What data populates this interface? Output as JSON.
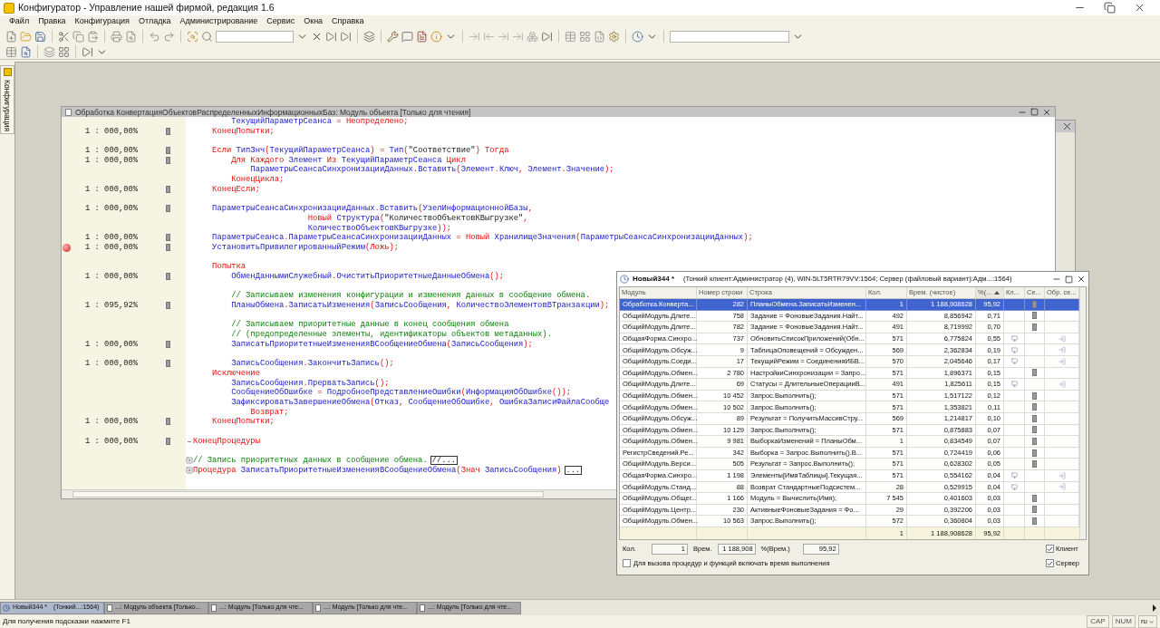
{
  "window": {
    "title": "Конфигуратор - Управление нашей фирмой, редакция 1.6"
  },
  "menu": [
    "Файл",
    "Правка",
    "Конфигурация",
    "Отладка",
    "Администрирование",
    "Сервис",
    "Окна",
    "Справка"
  ],
  "side_tab": {
    "label": "Конфигурация"
  },
  "code_window": {
    "title": "Обработка КонвертацияОбъектовРаспределенныхИнформационныхБаз: Модуль объекта [Только для чтения]",
    "lines": [
      {
        "breakpoint": false,
        "segments": [
          {
            "kind": "id",
            "text": "        ТекущийПараметрСеанса"
          },
          {
            "kind": "kw",
            "text": " = Неопределено;"
          }
        ]
      },
      {
        "count": "1 : 000,00%",
        "breakpoint": false,
        "segments": [
          {
            "kind": "kw",
            "text": "    КонецПопытки;"
          }
        ]
      },
      {
        "breakpoint": false
      },
      {
        "count": "1 : 000,00%",
        "breakpoint": false,
        "segments": [
          {
            "kind": "kw",
            "text": "    Если "
          },
          {
            "kind": "id",
            "text": "ТипЗнч"
          },
          {
            "kind": "kw",
            "text": "("
          },
          {
            "kind": "id",
            "text": "ТекущийПараметрСеанса"
          },
          {
            "kind": "kw",
            "text": ") = "
          },
          {
            "kind": "id",
            "text": "Тип"
          },
          {
            "kind": "kw",
            "text": "("
          },
          {
            "kind": "str",
            "text": "\"Соответствие\""
          },
          {
            "kind": "kw",
            "text": ") Тогда"
          }
        ]
      },
      {
        "count": "1 : 000,00%",
        "breakpoint": false,
        "segments": [
          {
            "kind": "kw",
            "text": "        Для Каждого "
          },
          {
            "kind": "id",
            "text": "Элемент "
          },
          {
            "kind": "kw",
            "text": "Из "
          },
          {
            "kind": "id",
            "text": "ТекущийПараметрСеанса "
          },
          {
            "kind": "kw",
            "text": "Цикл"
          }
        ]
      },
      {
        "breakpoint": false,
        "segments": [
          {
            "kind": "id",
            "text": "            ПараметрыСеансаСинхронизацииДанных"
          },
          {
            "kind": "kw",
            "text": "."
          },
          {
            "kind": "id",
            "text": "Вставить"
          },
          {
            "kind": "kw",
            "text": "("
          },
          {
            "kind": "id",
            "text": "Элемент"
          },
          {
            "kind": "kw",
            "text": "."
          },
          {
            "kind": "id",
            "text": "Ключ"
          },
          {
            "kind": "kw",
            "text": ", "
          },
          {
            "kind": "id",
            "text": "Элемент"
          },
          {
            "kind": "kw",
            "text": "."
          },
          {
            "kind": "id",
            "text": "Значение"
          },
          {
            "kind": "kw",
            "text": ");"
          }
        ]
      },
      {
        "breakpoint": false,
        "segments": [
          {
            "kind": "kw",
            "text": "        КонецЦикла;"
          }
        ]
      },
      {
        "count": "1 : 000,00%",
        "breakpoint": false,
        "segments": [
          {
            "kind": "kw",
            "text": "    КонецЕсли;"
          }
        ]
      },
      {
        "breakpoint": false
      },
      {
        "count": "1 : 000,00%",
        "breakpoint": false,
        "segments": [
          {
            "kind": "id",
            "text": "    ПараметрыСеансаСинхронизацииДанных"
          },
          {
            "kind": "kw",
            "text": "."
          },
          {
            "kind": "id",
            "text": "Вставить"
          },
          {
            "kind": "kw",
            "text": "("
          },
          {
            "kind": "id",
            "text": "УзелИнформационнойБазы"
          },
          {
            "kind": "kw",
            "text": ","
          }
        ]
      },
      {
        "breakpoint": false,
        "segments": [
          {
            "kind": "kw",
            "text": "                        Новый "
          },
          {
            "kind": "id",
            "text": "Структура"
          },
          {
            "kind": "kw",
            "text": "("
          },
          {
            "kind": "str",
            "text": "\"КоличествоОбъектовКВыгрузке\""
          },
          {
            "kind": "kw",
            "text": ","
          }
        ]
      },
      {
        "breakpoint": false,
        "segments": [
          {
            "kind": "id",
            "text": "                        КоличествоОбъектовКВыгрузке"
          },
          {
            "kind": "kw",
            "text": "));"
          }
        ]
      },
      {
        "count": "1 : 000,00%",
        "breakpoint": false,
        "segments": [
          {
            "kind": "id",
            "text": "    ПараметрыСеанса"
          },
          {
            "kind": "kw",
            "text": "."
          },
          {
            "kind": "id",
            "text": "ПараметрыСеансаСинхронизацииДанных"
          },
          {
            "kind": "kw",
            "text": " = Новый "
          },
          {
            "kind": "id",
            "text": "ХранилищеЗначения"
          },
          {
            "kind": "kw",
            "text": "("
          },
          {
            "kind": "id",
            "text": "ПараметрыСеансаСинхронизацииДанных"
          },
          {
            "kind": "kw",
            "text": ");"
          }
        ]
      },
      {
        "count": "1 : 000,00%",
        "breakpoint": true,
        "segments": [
          {
            "kind": "id",
            "text": "    УстановитьПривилегированныйРежим"
          },
          {
            "kind": "kw",
            "text": "(Ложь);"
          }
        ]
      },
      {
        "breakpoint": false
      },
      {
        "breakpoint": false,
        "segments": [
          {
            "kind": "kw",
            "text": "    Попытка"
          }
        ]
      },
      {
        "count": "1 : 000,00%",
        "breakpoint": false,
        "segments": [
          {
            "kind": "id",
            "text": "        ОбменДаннымиСлужебный"
          },
          {
            "kind": "kw",
            "text": "."
          },
          {
            "kind": "id",
            "text": "ОчиститьПриоритетныеДанныеОбмена"
          },
          {
            "kind": "kw",
            "text": "();"
          }
        ]
      },
      {
        "breakpoint": false
      },
      {
        "breakpoint": false,
        "segments": [
          {
            "kind": "cm",
            "text": "        // Записываем изменения конфигурации и изменения данных в сообщение обмена."
          }
        ]
      },
      {
        "count": "1 : 095,92%",
        "breakpoint": false,
        "segments": [
          {
            "kind": "id",
            "text": "        ПланыОбмена"
          },
          {
            "kind": "kw",
            "text": "."
          },
          {
            "kind": "id",
            "text": "ЗаписатьИзменения"
          },
          {
            "kind": "kw",
            "text": "("
          },
          {
            "kind": "id",
            "text": "ЗаписьСообщения"
          },
          {
            "kind": "kw",
            "text": ", "
          },
          {
            "kind": "id",
            "text": "КоличествоЭлементовВТранзакции"
          },
          {
            "kind": "kw",
            "text": ");"
          }
        ]
      },
      {
        "breakpoint": false
      },
      {
        "breakpoint": false,
        "segments": [
          {
            "kind": "cm",
            "text": "        // Записываем приоритетные данные в конец сообщения обмена"
          }
        ]
      },
      {
        "breakpoint": false,
        "segments": [
          {
            "kind": "cm",
            "text": "        // (предопределенные элементы, идентификаторы объектов метаданных)."
          }
        ]
      },
      {
        "count": "1 : 000,00%",
        "breakpoint": false,
        "segments": [
          {
            "kind": "id",
            "text": "        ЗаписатьПриоритетныеИзмененияВСообщениеОбмена"
          },
          {
            "kind": "kw",
            "text": "("
          },
          {
            "kind": "id",
            "text": "ЗаписьСообщения"
          },
          {
            "kind": "kw",
            "text": ");"
          }
        ]
      },
      {
        "breakpoint": false
      },
      {
        "count": "1 : 000,00%",
        "breakpoint": false,
        "segments": [
          {
            "kind": "id",
            "text": "        ЗаписьСообщения"
          },
          {
            "kind": "kw",
            "text": "."
          },
          {
            "kind": "id",
            "text": "ЗакончитьЗапись"
          },
          {
            "kind": "kw",
            "text": "();"
          }
        ]
      },
      {
        "breakpoint": false,
        "segments": [
          {
            "kind": "kw",
            "text": "    Исключение"
          }
        ]
      },
      {
        "breakpoint": false,
        "segments": [
          {
            "kind": "id",
            "text": "        ЗаписьСообщения"
          },
          {
            "kind": "kw",
            "text": "."
          },
          {
            "kind": "id",
            "text": "ПрерватьЗапись"
          },
          {
            "kind": "kw",
            "text": "();"
          }
        ]
      },
      {
        "breakpoint": false,
        "segments": [
          {
            "kind": "id",
            "text": "        СообщениеОбОшибке"
          },
          {
            "kind": "kw",
            "text": " = "
          },
          {
            "kind": "id",
            "text": "ПодробноеПредставлениеОшибки"
          },
          {
            "kind": "kw",
            "text": "("
          },
          {
            "kind": "id",
            "text": "ИнформацияОбОшибке"
          },
          {
            "kind": "kw",
            "text": "());"
          }
        ]
      },
      {
        "breakpoint": false,
        "segments": [
          {
            "kind": "id",
            "text": "        ЗафиксироватьЗавершениеОбмена"
          },
          {
            "kind": "kw",
            "text": "("
          },
          {
            "kind": "id",
            "text": "Отказ"
          },
          {
            "kind": "kw",
            "text": ", "
          },
          {
            "kind": "id",
            "text": "СообщениеОбОшибке"
          },
          {
            "kind": "kw",
            "text": ", "
          },
          {
            "kind": "id",
            "text": "ОшибкаЗаписиФайлаСообще"
          }
        ]
      },
      {
        "breakpoint": false,
        "segments": [
          {
            "kind": "kw",
            "text": "            Возврат;"
          }
        ]
      },
      {
        "count": "1 : 000,00%",
        "breakpoint": false,
        "segments": [
          {
            "kind": "kw",
            "text": "    КонецПопытки;"
          }
        ]
      },
      {
        "breakpoint": false
      },
      {
        "count": "1 : 000,00%",
        "breakpoint": false,
        "kind": "fold_end",
        "segments": [
          {
            "kind": "kw",
            "text": "КонецПроцедуры"
          }
        ]
      },
      {
        "breakpoint": false
      },
      {
        "breakpoint": false,
        "kind": "fold_start",
        "collapsed": "//...",
        "segments": [
          {
            "kind": "cm",
            "text": "// Запись приоритетных данных в сообщение обмена."
          }
        ]
      },
      {
        "breakpoint": false,
        "kind": "fold_start",
        "collapsed": "...",
        "segments": [
          {
            "kind": "kw",
            "text": "Процедура "
          },
          {
            "kind": "id",
            "text": "ЗаписатьПриоритетныеИзмененияВСообщениеОбмена"
          },
          {
            "kind": "kw",
            "text": "(Знач "
          },
          {
            "kind": "id",
            "text": "ЗаписьСообщения"
          },
          {
            "kind": "kw",
            "text": ")"
          }
        ]
      }
    ]
  },
  "profiler": {
    "title": "Новый344 *",
    "subtitle": "(Тонкий клиент:Администратор (4), WIN-5LT5RTR79VV:1564; Сервер (файловый вариант):Адм...:1564)",
    "columns": [
      {
        "label": "Модуль",
        "sorted": false
      },
      {
        "label": "Номер строки",
        "sorted": false
      },
      {
        "label": "Строка",
        "sorted": false
      },
      {
        "label": "Кол.",
        "sorted": false
      },
      {
        "label": "Врем. (чистое)",
        "sorted": false
      },
      {
        "label": "%(...",
        "sorted": true
      },
      {
        "label": "Кл...",
        "sorted": false
      },
      {
        "label": "Се...",
        "sorted": false
      },
      {
        "label": "Обр. се...",
        "sorted": false
      }
    ],
    "rows": [
      {
        "module": "Обработка.Конверта...",
        "line": "282",
        "code": "ПланыОбмена.ЗаписатьИзменен...",
        "count": "1",
        "time": "1 188,908628",
        "percent": "95,92",
        "kind": "server",
        "selected": true
      },
      {
        "module": "ОбщийМодуль.Длите...",
        "line": "758",
        "code": "Задание = ФоновыеЗадания.Найт...",
        "count": "492",
        "time": "8,856942",
        "percent": "0,71",
        "kind": "server",
        "selected": false
      },
      {
        "module": "ОбщийМодуль.Длите...",
        "line": "782",
        "code": "Задание = ФоновыеЗадания.Найт...",
        "count": "491",
        "time": "8,719992",
        "percent": "0,70",
        "kind": "server",
        "selected": false
      },
      {
        "module": "ОбщаяФорма.Синхро...",
        "line": "737",
        "code": "ОбновитьСписокПриложений(Обн...",
        "count": "571",
        "time": "6,775824",
        "percent": "0,55",
        "kind": "client",
        "selected": false
      },
      {
        "module": "ОбщийМодуль.Обсуж...",
        "line": "9",
        "code": "ТаблицаОповещений = Обсужден...",
        "count": "569",
        "time": "2,362834",
        "percent": "0,19",
        "kind": "client",
        "selected": false
      },
      {
        "module": "ОбщийМодуль.Соеди...",
        "line": "17",
        "code": "ТекущийРежим = СоединенияИБВ...",
        "count": "570",
        "time": "2,045646",
        "percent": "0,17",
        "kind": "client",
        "selected": false
      },
      {
        "module": "ОбщийМодуль.Обмен...",
        "line": "2 780",
        "code": "НастройкиСинхронизации = Запро...",
        "count": "571",
        "time": "1,896371",
        "percent": "0,15",
        "kind": "server",
        "selected": false
      },
      {
        "module": "ОбщийМодуль.Длите...",
        "line": "69",
        "code": "Статусы = ДлительныеОперацииВ...",
        "count": "491",
        "time": "1,825611",
        "percent": "0,15",
        "kind": "client",
        "selected": false
      },
      {
        "module": "ОбщийМодуль.Обмен...",
        "line": "10 452",
        "code": "Запрос.Выполнить();",
        "count": "571",
        "time": "1,517122",
        "percent": "0,12",
        "kind": "server",
        "selected": false
      },
      {
        "module": "ОбщийМодуль.Обмен...",
        "line": "10 502",
        "code": "Запрос.Выполнить();",
        "count": "571",
        "time": "1,353821",
        "percent": "0,11",
        "kind": "server",
        "selected": false
      },
      {
        "module": "ОбщийМодуль.Обсуж...",
        "line": "89",
        "code": "Результат = ПолучитьМассивСтру...",
        "count": "569",
        "time": "1,214817",
        "percent": "0,10",
        "kind": "server",
        "selected": false
      },
      {
        "module": "ОбщийМодуль.Обмен...",
        "line": "10 129",
        "code": "Запрос.Выполнить();",
        "count": "571",
        "time": "0,875883",
        "percent": "0,07",
        "kind": "server",
        "selected": false
      },
      {
        "module": "ОбщийМодуль.Обмен...",
        "line": "9 981",
        "code": "ВыборкаИзменений = ПланыОбм...",
        "count": "1",
        "time": "0,834549",
        "percent": "0,07",
        "kind": "server",
        "selected": false
      },
      {
        "module": "РегистрСведений.Ре...",
        "line": "342",
        "code": "Выборка = Запрос.Выполнить().В...",
        "count": "571",
        "time": "0,724419",
        "percent": "0,06",
        "kind": "server",
        "selected": false
      },
      {
        "module": "ОбщийМодуль.Верси...",
        "line": "505",
        "code": "Результат = Запрос.Выполнить();",
        "count": "571",
        "time": "0,628302",
        "percent": "0,05",
        "kind": "server",
        "selected": false
      },
      {
        "module": "ОбщаяФорма.Синхро...",
        "line": "1 198",
        "code": "Элементы[ИмяТаблицы].Текущая...",
        "count": "571",
        "time": "0,554162",
        "percent": "0,04",
        "kind": "client",
        "selected": false
      },
      {
        "module": "ОбщийМодуль.Станд...",
        "line": "88",
        "code": "Возврат СтандартныеПодсистем...",
        "count": "28",
        "time": "0,529915",
        "percent": "0,04",
        "kind": "client",
        "selected": false
      },
      {
        "module": "ОбщийМодуль.Общег...",
        "line": "1 166",
        "code": "Модуль = Вычислить(Имя);",
        "count": "7 545",
        "time": "0,401603",
        "percent": "0,03",
        "kind": "server",
        "selected": false
      },
      {
        "module": "ОбщийМодуль.Центр...",
        "line": "230",
        "code": "АктивныеФоновыеЗадания = Фо...",
        "count": "29",
        "time": "0,392206",
        "percent": "0,03",
        "kind": "server",
        "selected": false
      },
      {
        "module": "ОбщийМодуль.Обмен...",
        "line": "10 563",
        "code": "Запрос.Выполнить();",
        "count": "572",
        "time": "0,360804",
        "percent": "0,03",
        "kind": "server",
        "selected": false
      }
    ],
    "totals": {
      "count": "1",
      "time": "1 188,908628",
      "percent": "95,92"
    },
    "footer": {
      "count_label": "Кол.",
      "count": "1",
      "time_label": "Врем.",
      "time": "1 188,908",
      "percent_label": "%(Врем.)",
      "percent": "95,92"
    },
    "include_time": {
      "label": "Для вызова процедур и функций включать время выполнения",
      "checked": false
    },
    "filters": [
      {
        "label": "Клиент",
        "checked": true
      },
      {
        "label": "Сервер",
        "checked": true
      }
    ]
  },
  "taskbar": [
    {
      "label": "Новый344 *",
      "detail": "(Тонкий...:1564)",
      "kind": "profiler",
      "selected": true
    },
    {
      "label": "...: Модуль объекта [Только...",
      "kind": "module",
      "selected": false
    },
    {
      "label": "...: Модуль [Только для чте...",
      "kind": "module",
      "selected": false
    },
    {
      "label": "...: Модуль [Только для чте...",
      "kind": "module",
      "selected": false
    },
    {
      "label": "...: Модуль [Только для чте...",
      "kind": "module",
      "selected": false
    }
  ],
  "status_bar": {
    "hint": "Для получения подсказки нажмите F1",
    "indicators": [
      "CAP",
      "NUM"
    ],
    "language": "ru"
  }
}
